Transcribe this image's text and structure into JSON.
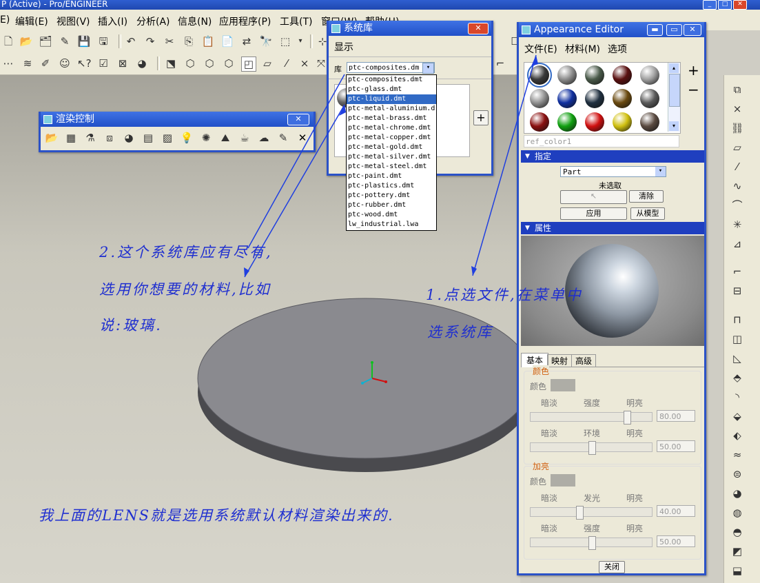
{
  "app": {
    "title": "P (Active) - Pro/ENGINEER",
    "menu": [
      "E)",
      "编辑(E)",
      "视图(V)",
      "插入(I)",
      "分析(A)",
      "信息(N)",
      "应用程序(P)",
      "工具(T)",
      "窗口(W)",
      "帮助(H)"
    ]
  },
  "render_control": {
    "title": "渲染控制",
    "close_icon": "✕"
  },
  "system_library": {
    "title": "系统库",
    "menu_display": "显示",
    "lib_label": "库",
    "selected": "ptc-composites.dm",
    "options": [
      "ptc-composites.dmt",
      "ptc-glass.dmt",
      "ptc-liquid.dmt",
      "ptc-metal-aluminium.d",
      "ptc-metal-brass.dmt",
      "ptc-metal-chrome.dmt",
      "ptc-metal-copper.dmt",
      "ptc-metal-gold.dmt",
      "ptc-metal-silver.dmt",
      "ptc-metal-steel.dmt",
      "ptc-paint.dmt",
      "ptc-plastics.dmt",
      "ptc-pottery.dmt",
      "ptc-rubber.dmt",
      "ptc-wood.dmt",
      "lw_industrial.lwa"
    ],
    "highlighted_index": 2,
    "add_button": "+"
  },
  "appearance_editor": {
    "title": "Appearance Editor",
    "menu": [
      "文件(E)",
      "材料(M)",
      "选项"
    ],
    "ref_name": "ref_color1",
    "plus": "+",
    "minus": "−",
    "assign_header": "指定",
    "assign_dropdown": "Part",
    "no_selection": "未选取",
    "clear_button": "清除",
    "apply_button": "应用",
    "from_model_button": "从模型",
    "properties_header": "属性",
    "tabs": [
      "基本",
      "映射",
      "高级"
    ],
    "color_group": {
      "title": "颜色",
      "color_label": "颜色",
      "row1": {
        "left": "暗淡",
        "mid": "强度",
        "right": "明亮",
        "value": "80.00"
      },
      "row2": {
        "left": "暗淡",
        "mid": "环境",
        "right": "明亮",
        "value": "50.00"
      }
    },
    "highlight_group": {
      "title": "加亮",
      "color_label": "颜色",
      "row1": {
        "left": "暗淡",
        "mid": "发光",
        "right": "明亮",
        "value": "40.00"
      },
      "row2": {
        "left": "暗淡",
        "mid": "强度",
        "right": "明亮",
        "value": "50.00"
      }
    },
    "close_button": "关闭",
    "swatches": [
      "#3a3a3a",
      "#8c8c8c",
      "#4a5a4a",
      "#5a1010",
      "#a0a0a0",
      "#909090",
      "#1030a0",
      "#203040",
      "#6a4a10",
      "#5a5a5a",
      "#8a1010",
      "#10a010",
      "#d01010",
      "#d0c010",
      "#5a4a40"
    ]
  },
  "annotations": {
    "note2_line1": "2.这个系统库应有尽有,",
    "note2_line2": "选用你想要的材料,比如",
    "note2_line3": "说:玻璃.",
    "note1_line1": "1.点选文件,在菜单中",
    "note1_line2": "选系统库",
    "note3": "我上面的LENS就是选用系统默认材料渲染出来的."
  }
}
